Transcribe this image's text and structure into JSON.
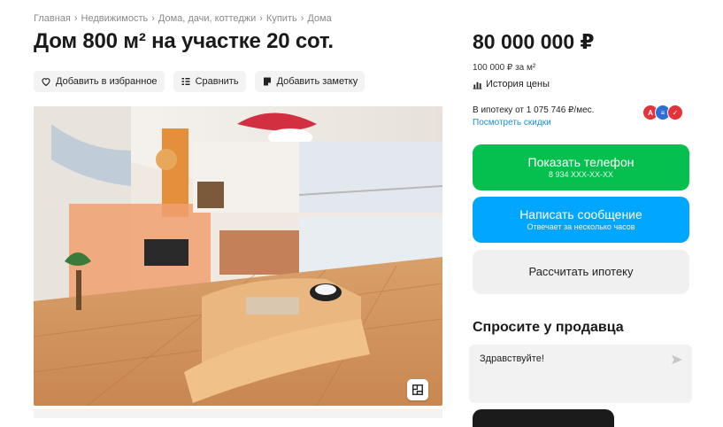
{
  "breadcrumbs": [
    "Главная",
    "Недвижимость",
    "Дома, дачи, коттеджи",
    "Купить",
    "Дома"
  ],
  "title": "Дом 800 м² на участке 20 сот.",
  "actions": {
    "favorite": "Добавить в избранное",
    "compare": "Сравнить",
    "note": "Добавить заметку"
  },
  "price": {
    "total": "80 000 000 ₽",
    "per_m2": "100 000 ₽ за м²",
    "history": "История цены"
  },
  "mortgage": {
    "text": "В ипотеку от 1 075 746 ₽/мес.",
    "discounts": "Посмотреть скидки"
  },
  "buttons": {
    "phone_title": "Показать телефон",
    "phone_number": "8 934 XXX-XX-XX",
    "message_title": "Написать сообщение",
    "message_sub": "Отвечает за несколько часов",
    "calc": "Рассчитать ипотеку"
  },
  "ask": {
    "title": "Спросите у продавца",
    "message": "Здравствуйте!"
  },
  "colors": {
    "phone_green": "#05c04f",
    "message_blue": "#00a6ff",
    "link_blue": "#1d8ed6",
    "bank_red": "#e5323b",
    "bank_blue": "#2d6fd6"
  },
  "icons": [
    "heart-icon",
    "compare-icon",
    "note-icon",
    "chart-icon",
    "floorplan-icon",
    "send-icon"
  ]
}
